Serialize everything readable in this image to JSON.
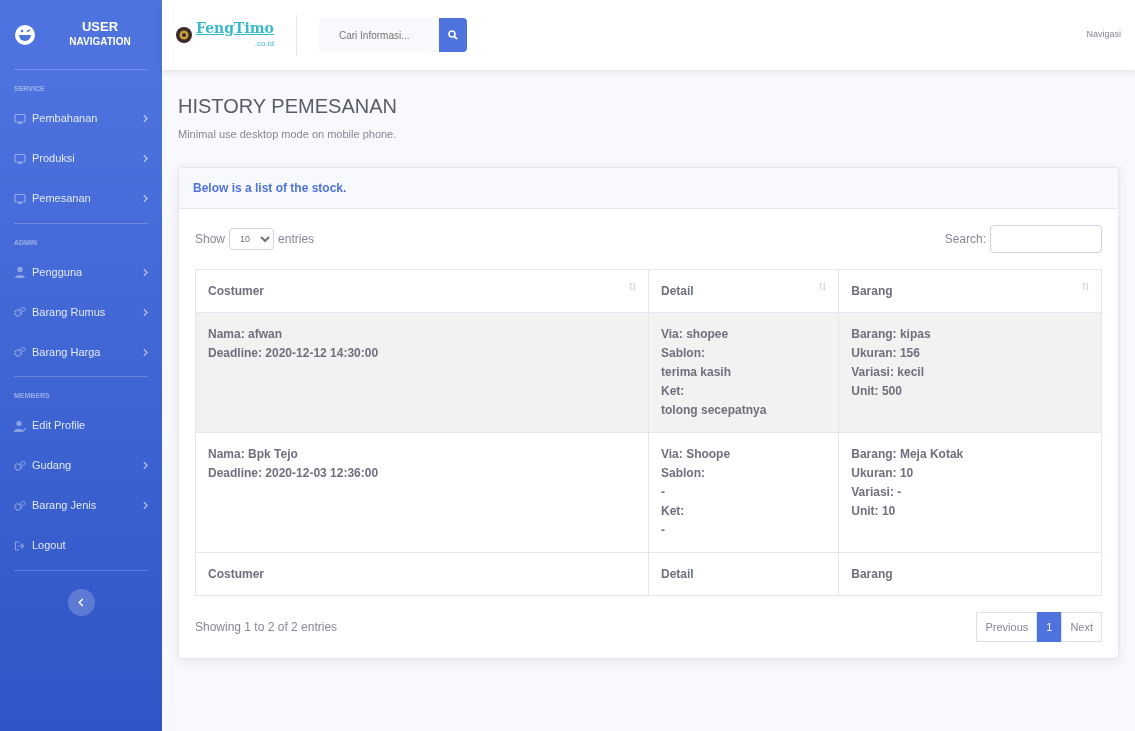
{
  "sidebar": {
    "brand": {
      "line1": "USER",
      "line2": "NAVIGATION"
    },
    "sections": [
      {
        "heading": "SERVICE",
        "items": [
          {
            "label": "Pembahanan",
            "kind": "monitor",
            "expandable": true
          },
          {
            "label": "Produksi",
            "kind": "monitor",
            "expandable": true
          },
          {
            "label": "Pemesanan",
            "kind": "monitor",
            "expandable": true
          }
        ]
      },
      {
        "heading": "ADMIN",
        "items": [
          {
            "label": "Pengguna",
            "kind": "user",
            "expandable": true
          },
          {
            "label": "Barang Rumus",
            "kind": "gears",
            "expandable": true
          },
          {
            "label": "Barang Harga",
            "kind": "gears",
            "expandable": true
          }
        ]
      },
      {
        "heading": "MEMBERS",
        "items": [
          {
            "label": "Edit Profile",
            "kind": "useredit",
            "expandable": false
          },
          {
            "label": "Gudang",
            "kind": "gears",
            "expandable": true
          },
          {
            "label": "Barang Jenis",
            "kind": "gears",
            "expandable": true
          },
          {
            "label": "Logout",
            "kind": "logout",
            "expandable": false
          }
        ]
      }
    ]
  },
  "topbar": {
    "logo": {
      "name": "FengTimo",
      "suffix": ".co.id"
    },
    "search": {
      "placeholder": "Cari Informasi..."
    },
    "menu": "Navigasi"
  },
  "page": {
    "title": "HISTORY PEMESANAN",
    "subtitle": "Minimal use desktop mode on mobile phone."
  },
  "card": {
    "title": "Below is a list of the stock.",
    "length": {
      "show": "Show",
      "value": "10",
      "entries": "entries"
    },
    "search_label": "Search:",
    "table": {
      "columns": [
        "Costumer",
        "Detail",
        "Barang"
      ],
      "rows": [
        {
          "highlighted": true,
          "cells": [
            [
              "Nama: afwan",
              "Deadline: 2020-12-12 14:30:00"
            ],
            [
              "Via: shopee",
              "Sablon:",
              "terima kasih",
              "Ket:",
              "tolong secepatnya"
            ],
            [
              "Barang: kipas",
              "Ukuran: 156",
              "Variasi: kecil",
              "Unit: 500"
            ]
          ]
        },
        {
          "highlighted": false,
          "cells": [
            [
              "Nama: Bpk Tejo",
              "Deadline: 2020-12-03 12:36:00"
            ],
            [
              "Via: Shoope",
              "Sablon:",
              "-",
              "Ket:",
              "-"
            ],
            [
              "Barang: Meja Kotak",
              "Ukuran: 10",
              "Variasi: -",
              "Unit: 10"
            ]
          ]
        }
      ],
      "footer": [
        "Costumer",
        "Detail",
        "Barang"
      ]
    },
    "info": "Showing 1 to 2 of 2 entries",
    "pagination": [
      {
        "label": "Previous",
        "selected": false
      },
      {
        "label": "1",
        "selected": true
      },
      {
        "label": "Next",
        "selected": false
      }
    ]
  }
}
